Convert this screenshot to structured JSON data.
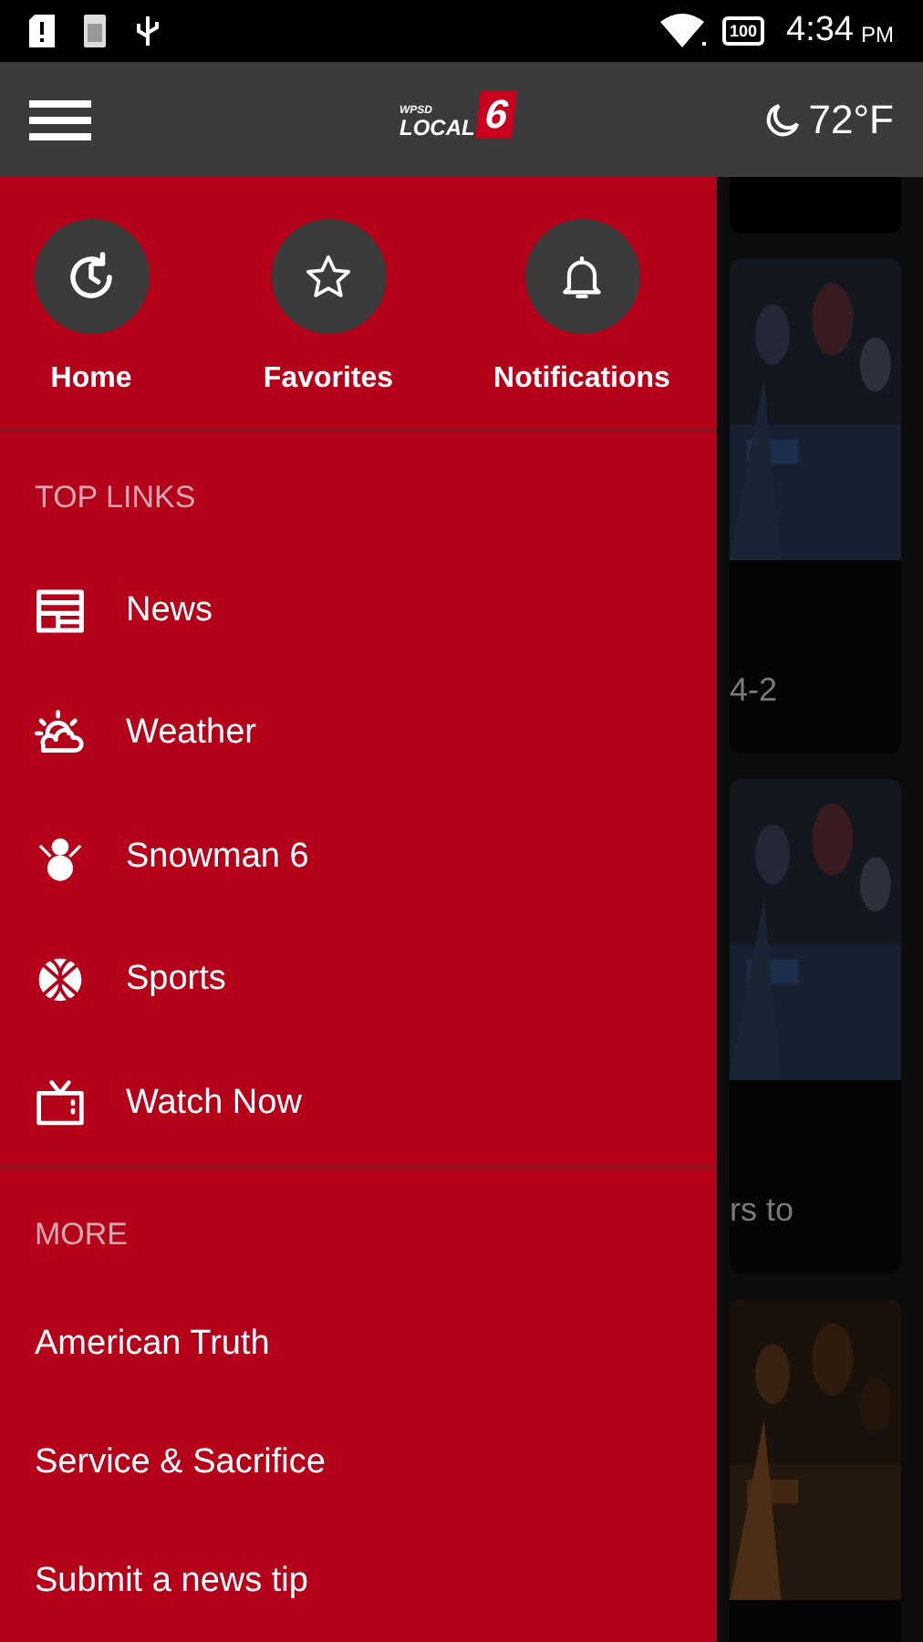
{
  "status_bar": {
    "battery": "100",
    "time": "4:34",
    "ampm": "PM"
  },
  "app_bar": {
    "logo": {
      "small": "WPSD",
      "main": "LOCAL",
      "number": "6"
    },
    "temperature": "72°F"
  },
  "drawer": {
    "quick_actions": [
      {
        "label": "Home"
      },
      {
        "label": "Favorites"
      },
      {
        "label": "Notifications"
      }
    ],
    "sections": [
      {
        "title": "TOP LINKS",
        "kind": "icon-list",
        "items": [
          {
            "label": "News"
          },
          {
            "label": "Weather"
          },
          {
            "label": "Snowman 6"
          },
          {
            "label": "Sports"
          },
          {
            "label": "Watch Now"
          }
        ]
      },
      {
        "title": "MORE",
        "kind": "text-list",
        "items": [
          {
            "label": "American Truth"
          },
          {
            "label": "Service & Sacrifice"
          },
          {
            "label": "Submit a news tip"
          }
        ]
      }
    ]
  },
  "background_cards": [
    {
      "kind": "blank"
    },
    {
      "kind": "picture",
      "caption": "4-2"
    },
    {
      "kind": "picture",
      "caption": "rs to"
    },
    {
      "kind": "picture"
    }
  ]
}
